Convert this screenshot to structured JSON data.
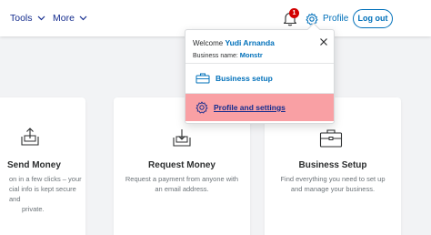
{
  "header": {
    "nav": [
      {
        "label": "Tools"
      },
      {
        "label": "More"
      }
    ],
    "notifications_count": "1",
    "profile_label": "Profile",
    "logout_label": "Log out"
  },
  "cards": [
    {
      "title": "Send Money",
      "desc_lines": [
        "on in a few clicks – your",
        "cial info is kept secure and",
        "private."
      ],
      "icon": "send-money-icon"
    },
    {
      "title": "Request Money",
      "desc_lines": [
        "Request a payment from anyone with",
        "an email address."
      ],
      "icon": "request-money-icon"
    },
    {
      "title": "Business Setup",
      "desc_lines": [
        "Find everything you need to set up",
        "and manage your business."
      ],
      "icon": "briefcase-icon"
    }
  ],
  "dropdown": {
    "welcome_prefix": "Welcome",
    "user_name": "Yudi Arnanda",
    "business_label": "Business name:",
    "business_value": "Monstr",
    "items": [
      {
        "label": "Business setup",
        "icon": "business-setup-icon"
      },
      {
        "label": "Profile and settings",
        "icon": "gear-icon",
        "highlighted": true
      }
    ]
  },
  "colors": {
    "brand_blue": "#0070ba",
    "nav_blue": "#142c8e",
    "highlight": "#f9a0a4",
    "badge_red": "#d20000"
  }
}
